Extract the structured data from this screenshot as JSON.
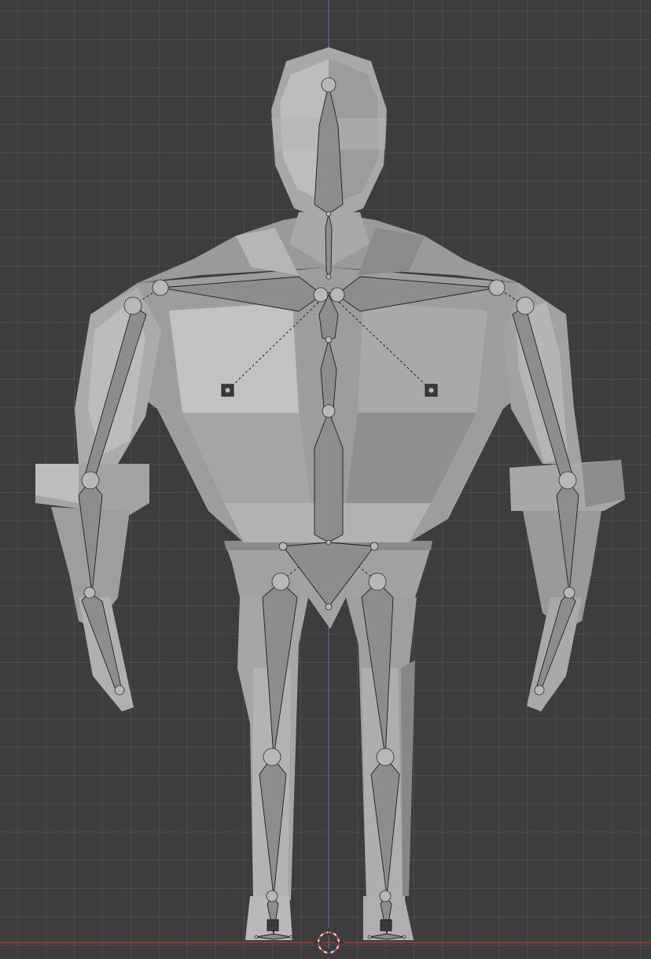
{
  "app": "3D viewport",
  "scene": {
    "object": "armature-on-lowpoly-character",
    "view": "front-orthographic",
    "colors": {
      "background": "#3d3d3d",
      "grid": "#4a4a4a",
      "x_axis": "#c0393b",
      "z_axis": "#3d6fb5",
      "mesh_light": "#b4b4b4",
      "mesh_mid": "#9c9c9c",
      "mesh_dark": "#7a7a7a",
      "bone": "#8d8d8d",
      "cursor": "#d33c3c"
    },
    "icons": [
      "3d-cursor-icon",
      "ik-target-icon"
    ]
  }
}
